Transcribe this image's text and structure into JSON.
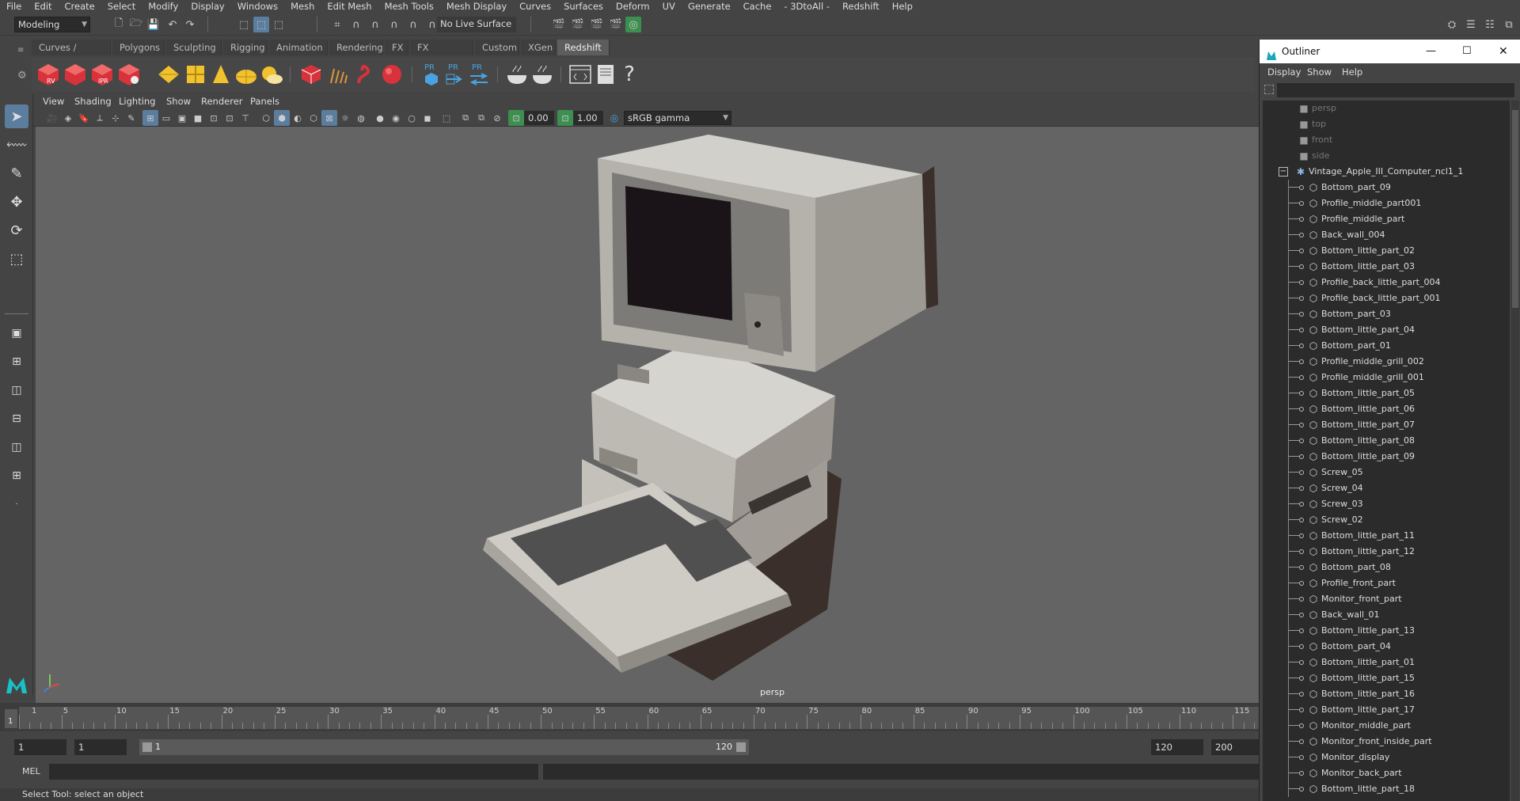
{
  "menubar": [
    "File",
    "Edit",
    "Create",
    "Select",
    "Modify",
    "Display",
    "Windows",
    "Mesh",
    "Edit Mesh",
    "Mesh Tools",
    "Mesh Display",
    "Curves",
    "Surfaces",
    "Deform",
    "UV",
    "Generate",
    "Cache",
    "- 3DtoAll -",
    "Redshift",
    "Help"
  ],
  "status": {
    "workspace": "Modeling",
    "live_surface": "No Live Surface"
  },
  "shelf_tabs": [
    "Curves / Surfaces",
    "Polygons",
    "Sculpting",
    "Rigging",
    "Animation",
    "Rendering",
    "FX",
    "FX Caching",
    "Custom",
    "XGen",
    "Redshift"
  ],
  "shelf_active": "Redshift",
  "shelf_icons": {
    "rv": "RV",
    "ipr": "IPR",
    "pr": "PR"
  },
  "viewport_menu": [
    "View",
    "Shading",
    "Lighting",
    "Show",
    "Renderer",
    "Panels"
  ],
  "viewport_toolbar": {
    "exposure": "0.00",
    "gamma": "1.00",
    "colorspace": "sRGB gamma"
  },
  "viewport_label": "persp",
  "timeline": {
    "ticks": [
      "1",
      "5",
      "10",
      "15",
      "20",
      "25",
      "30",
      "35",
      "40",
      "45",
      "50",
      "55",
      "60",
      "65",
      "70",
      "75",
      "80",
      "85",
      "90",
      "95",
      "100",
      "105",
      "110",
      "115"
    ],
    "current": "1"
  },
  "range": {
    "start": "1",
    "playback_start": "1",
    "slider_start": "1",
    "slider_end": "120",
    "playback_end": "120",
    "end": "200"
  },
  "command": {
    "lang": "MEL"
  },
  "help_line": "Select Tool: select an object",
  "outliner": {
    "title": "Outliner",
    "menu": [
      "Display",
      "Show",
      "Help"
    ],
    "cameras": [
      "persp",
      "top",
      "front",
      "side"
    ],
    "group": "Vintage_Apple_III_Computer_ncl1_1",
    "items": [
      "Bottom_part_09",
      "Profile_middle_part001",
      "Profile_middle_part",
      "Back_wall_004",
      "Bottom_little_part_02",
      "Bottom_little_part_03",
      "Profile_back_little_part_004",
      "Profile_back_little_part_001",
      "Bottom_part_03",
      "Bottom_little_part_04",
      "Bottom_part_01",
      "Profile_middle_grill_002",
      "Profile_middle_grill_001",
      "Bottom_little_part_05",
      "Bottom_little_part_06",
      "Bottom_little_part_07",
      "Bottom_little_part_08",
      "Bottom_little_part_09",
      "Screw_05",
      "Screw_04",
      "Screw_03",
      "Screw_02",
      "Bottom_little_part_11",
      "Bottom_little_part_12",
      "Bottom_part_08",
      "Profile_front_part",
      "Monitor_front_part",
      "Back_wall_01",
      "Bottom_little_part_13",
      "Bottom_part_04",
      "Bottom_little_part_01",
      "Bottom_little_part_15",
      "Bottom_little_part_16",
      "Bottom_little_part_17",
      "Monitor_middle_part",
      "Monitor_front_inside_part",
      "Monitor_display",
      "Monitor_back_part",
      "Bottom_little_part_18"
    ]
  },
  "colors": {
    "accent": "#5b7d9e",
    "viewport_bg": "#646464",
    "shelf_red": "#d8323a",
    "shelf_yellow": "#f2c12e",
    "pr_blue": "#4aa3e0"
  }
}
